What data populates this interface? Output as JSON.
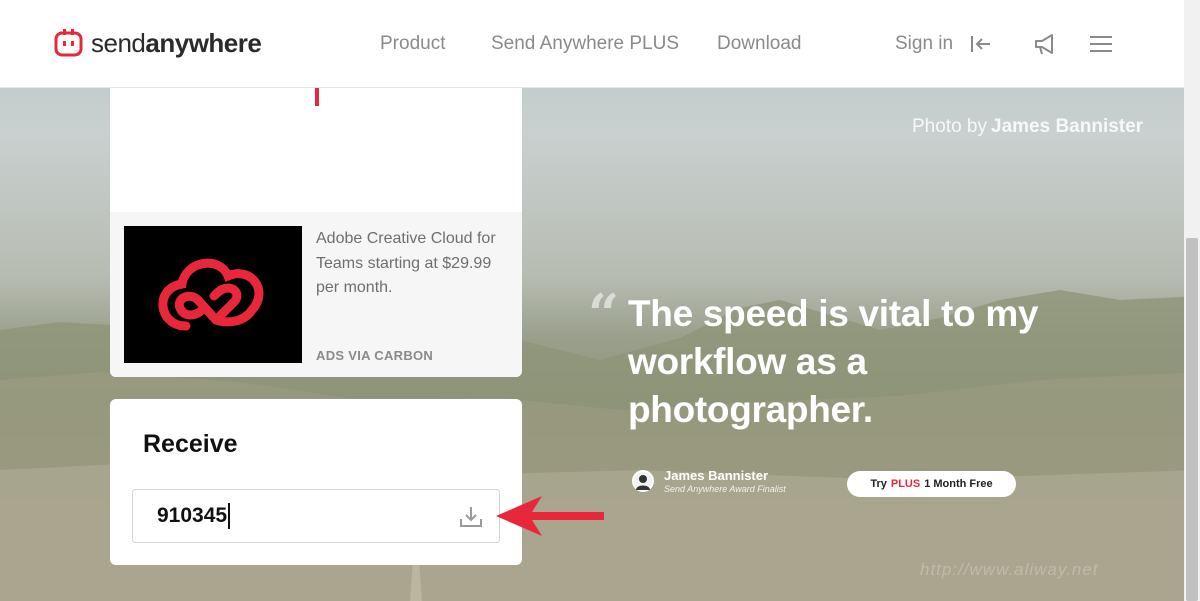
{
  "brand": {
    "name_regular": "send",
    "name_bold": "anywhere",
    "accent_color": "#e8283a"
  },
  "nav": {
    "links": [
      "Product",
      "Send Anywhere PLUS",
      "Download"
    ],
    "signin": "Sign in",
    "icons": [
      "sign-in-arrow-icon",
      "megaphone-icon",
      "hamburger-menu-icon"
    ]
  },
  "ad": {
    "text": "Adobe Creative Cloud for Teams starting at $29.99 per month.",
    "via": "ADS VIA CARBON"
  },
  "receive": {
    "title": "Receive",
    "input_value": "910345",
    "button_icon": "download-icon"
  },
  "hero": {
    "credit_prefix": "Photo by",
    "credit_name": "James Bannister",
    "quote_mark": "“",
    "quote": "The speed is vital to my workflow as a photographer.",
    "author_name": "James Bannister",
    "author_subtitle": "Send Anywhere Award Finalist",
    "cta_prefix": "Try",
    "cta_highlight": "PLUS",
    "cta_suffix": "1 Month Free"
  },
  "watermark": "http://www.aliway.net"
}
